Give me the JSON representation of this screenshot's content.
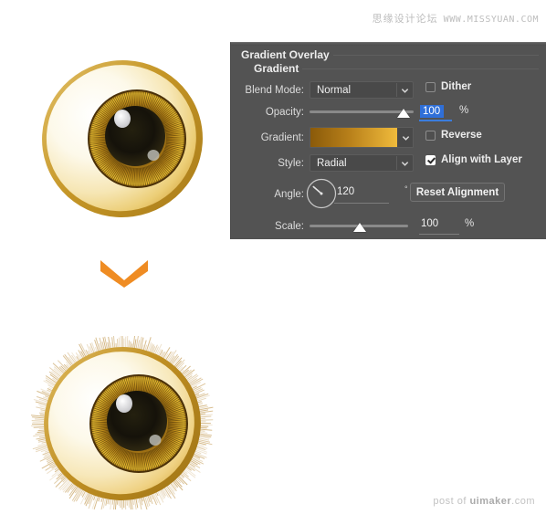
{
  "watermarks": {
    "top_cn": "思缘设计论坛",
    "top_url": "WWW.MISSYUAN.COM",
    "bottom_prefix": "post of ",
    "bottom_strong": "uimaker",
    "bottom_suffix": ".com"
  },
  "artwork": {
    "top_eye_name": "golden-eyeball-smooth",
    "bottom_eye_name": "golden-eyeball-with-lashes",
    "arrow_icon": "chevron-down-icon",
    "arrow_color": "#ef8c23",
    "sclera_light": "#fdfaf0",
    "sclera_gold": "#f0d27c",
    "rim_gold": "#c99a2e",
    "iris_dark": "#5b3a0d",
    "iris_gold": "#e5b324",
    "pupil": "#1d1a10",
    "highlight": "#f0f0f0",
    "lash_color": "#c8a05a"
  },
  "panel": {
    "title": "Gradient Overlay",
    "subtitle": "Gradient",
    "background_color": "#535353",
    "rows": {
      "blend_mode": {
        "label": "Blend Mode:",
        "value": "Normal"
      },
      "opacity": {
        "label": "Opacity:",
        "value": "100",
        "unit": "%",
        "slider_percent": 88
      },
      "gradient": {
        "label": "Gradient:",
        "stop_start": "#8a5a0a",
        "stop_mid": "#b8801a",
        "stop_end": "#f0bb3c"
      },
      "style": {
        "label": "Style:",
        "value": "Radial"
      },
      "angle": {
        "label": "Angle:",
        "value": "120",
        "unit": "°"
      },
      "scale": {
        "label": "Scale:",
        "value": "100",
        "unit": "%",
        "slider_percent": 48
      }
    },
    "checkboxes": {
      "dither": {
        "label": "Dither",
        "checked": false
      },
      "reverse": {
        "label": "Reverse",
        "checked": false
      },
      "align_with_layer": {
        "label": "Align with Layer",
        "checked": true
      }
    },
    "buttons": {
      "reset_alignment": "Reset Alignment"
    }
  }
}
